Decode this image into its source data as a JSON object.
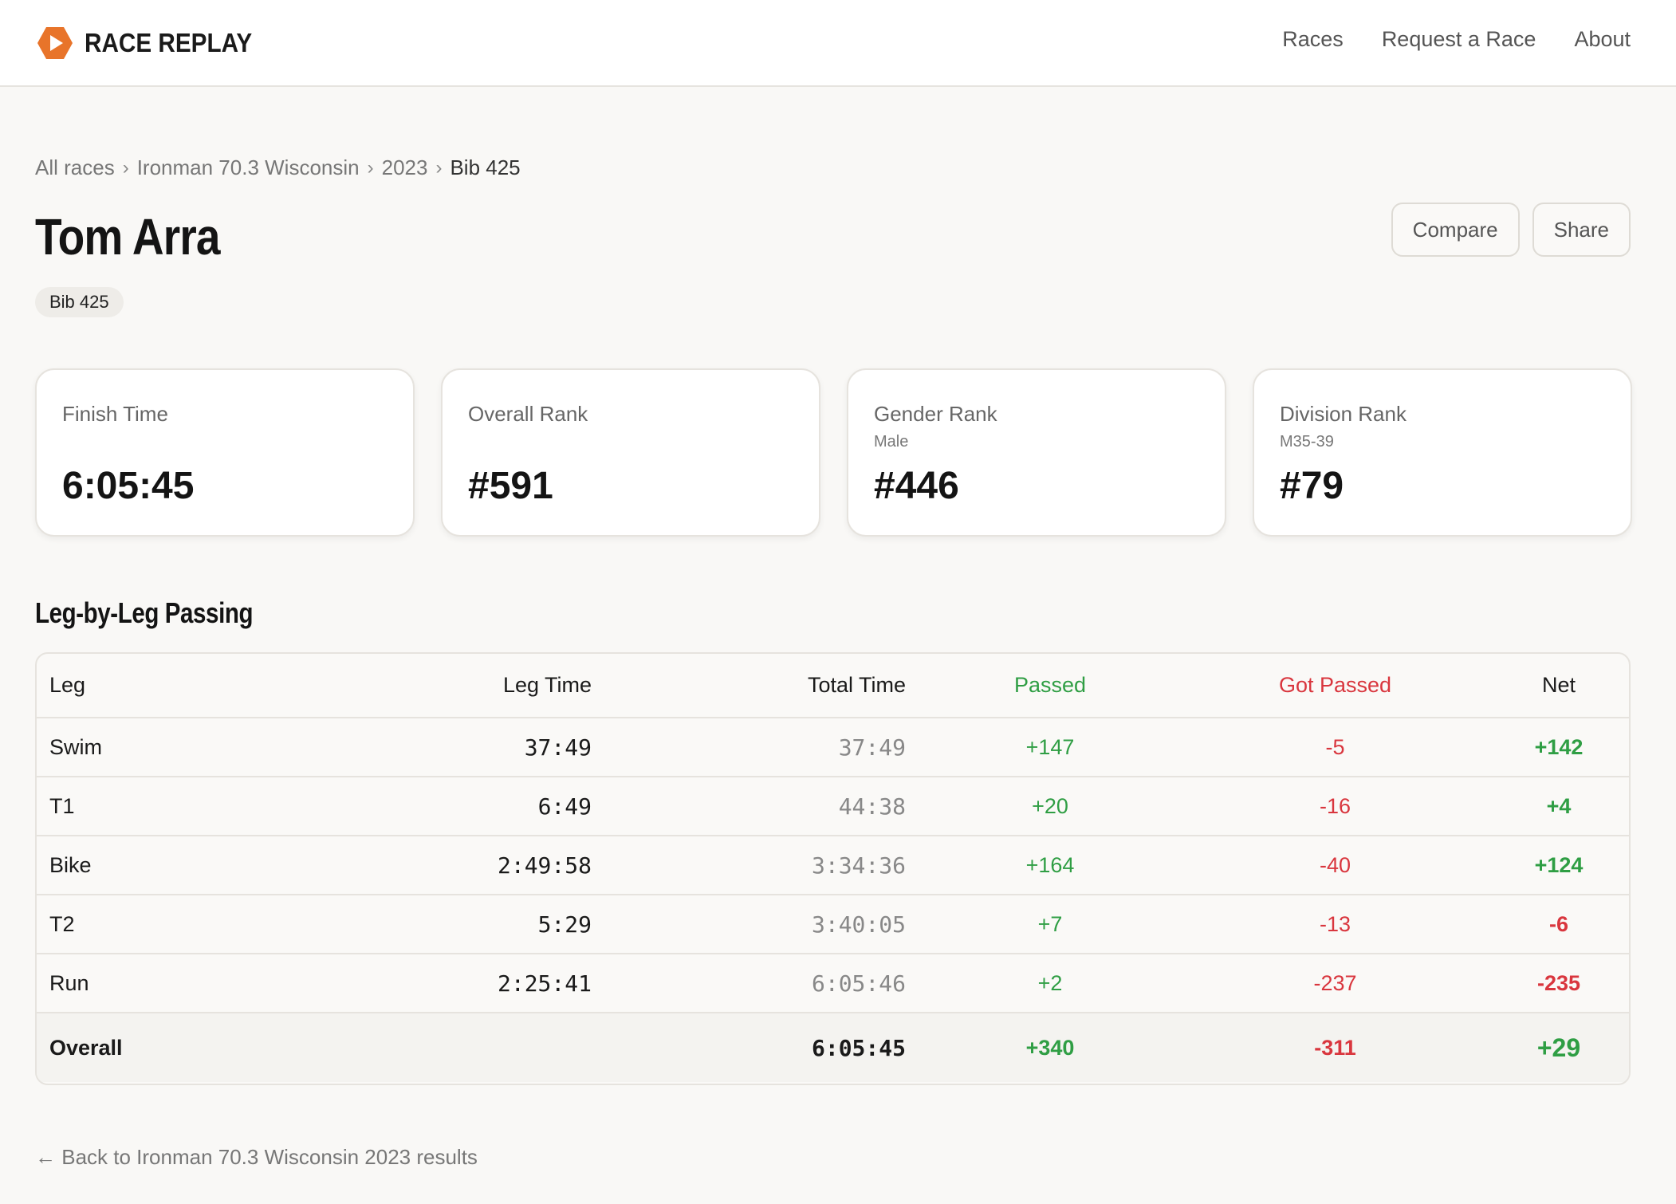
{
  "header": {
    "brand": "RACE REPLAY",
    "nav": [
      "Races",
      "Request a Race",
      "About"
    ]
  },
  "breadcrumb": {
    "items": [
      "All races",
      "Ironman 70.3 Wisconsin",
      "2023"
    ],
    "current": "Bib 425",
    "separator": "›"
  },
  "athlete": {
    "name": "Tom Arra",
    "bib": "Bib 425"
  },
  "actions": {
    "compare": "Compare",
    "share": "Share"
  },
  "stats": [
    {
      "label": "Finish Time",
      "sub": "",
      "value": "6:05:45"
    },
    {
      "label": "Overall Rank",
      "sub": "",
      "value": "#591"
    },
    {
      "label": "Gender Rank",
      "sub": "Male",
      "value": "#446"
    },
    {
      "label": "Division Rank",
      "sub": "M35-39",
      "value": "#79"
    }
  ],
  "passing": {
    "title": "Leg-by-Leg Passing",
    "columns": {
      "leg": "Leg",
      "leg_time": "Leg Time",
      "total_time": "Total Time",
      "passed": "Passed",
      "got_passed": "Got Passed",
      "net": "Net"
    },
    "rows": [
      {
        "leg": "Swim",
        "leg_time": "37:49",
        "total_time": "37:49",
        "passed": "+147",
        "got_passed": "-5",
        "net": "+142"
      },
      {
        "leg": "T1",
        "leg_time": "6:49",
        "total_time": "44:38",
        "passed": "+20",
        "got_passed": "-16",
        "net": "+4"
      },
      {
        "leg": "Bike",
        "leg_time": "2:49:58",
        "total_time": "3:34:36",
        "passed": "+164",
        "got_passed": "-40",
        "net": "+124"
      },
      {
        "leg": "T2",
        "leg_time": "5:29",
        "total_time": "3:40:05",
        "passed": "+7",
        "got_passed": "-13",
        "net": "-6"
      },
      {
        "leg": "Run",
        "leg_time": "2:25:41",
        "total_time": "6:05:46",
        "passed": "+2",
        "got_passed": "-237",
        "net": "-235"
      }
    ],
    "overall": {
      "leg": "Overall",
      "leg_time": "",
      "total_time": "6:05:45",
      "passed": "+340",
      "got_passed": "-311",
      "net": "+29"
    }
  },
  "back_link": "← Back to Ironman 70.3 Wisconsin 2023 results",
  "colors": {
    "brand_orange": "#e8742a",
    "positive": "#2f9e44",
    "negative": "#d9363e"
  }
}
